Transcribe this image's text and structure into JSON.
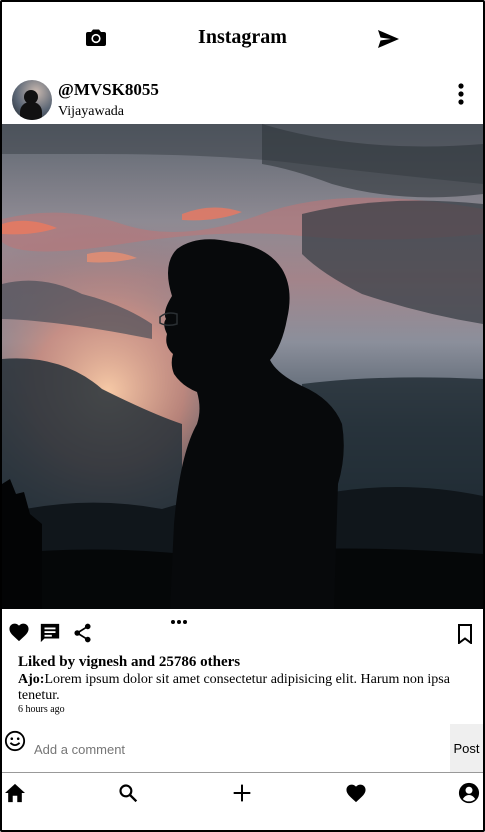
{
  "top_bar": {
    "title": "Instagram",
    "left_icon": "camera-icon",
    "right_icon": "send-icon"
  },
  "post": {
    "username": "@MVSK8055",
    "location": "Vijayawada",
    "image_description_icon": "post-photo",
    "likes_text": "Liked by vignesh and 25786 others",
    "caption_author": "Ajo:",
    "caption_text": "Lorem ipsum dolor sit amet consectetur adipisicing elit. Harum non ipsa tenetur.",
    "time_ago": "6 hours ago"
  },
  "comment": {
    "placeholder": "Add a comment",
    "post_label": "Post"
  },
  "nav": {
    "items": [
      "home-icon",
      "search-icon",
      "plus-icon",
      "heart-icon",
      "profile-icon"
    ]
  }
}
